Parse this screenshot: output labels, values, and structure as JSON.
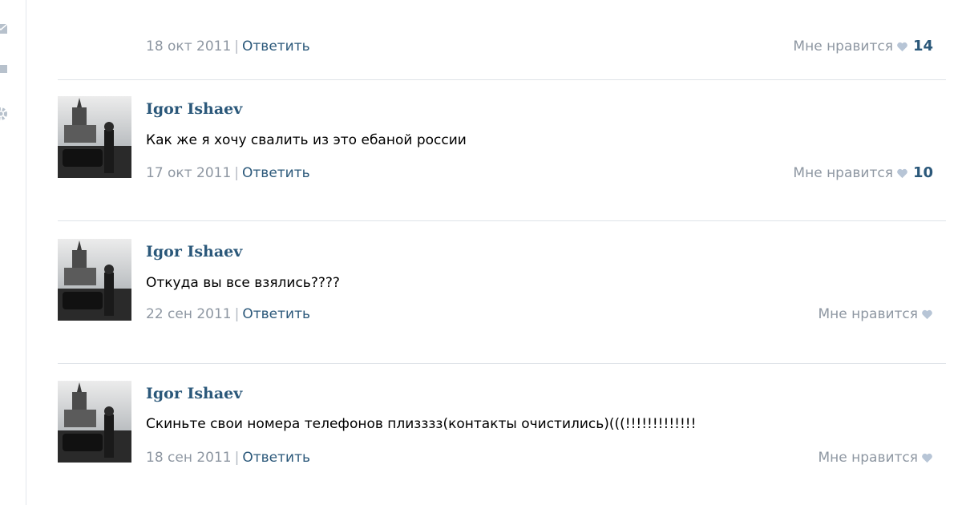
{
  "icons": {
    "rail": [
      "envelope-icon",
      "speech-bubble-icon",
      "gear-icon"
    ],
    "like": "heart-icon"
  },
  "colors": {
    "link": "#2b587a",
    "meta": "#8e97a2",
    "heart": "#b7c5d6",
    "divider": "#dfe3e8"
  },
  "separator": "|",
  "reply_label": "Ответить",
  "like_label": "Мне нравится",
  "top_comment": {
    "date": "18 окт 2011",
    "likes": "14"
  },
  "comments": [
    {
      "author": "Igor Ishaev",
      "text": "Как же я хочу свалить из это ебаной россии",
      "date": "17 окт 2011",
      "likes": "10"
    },
    {
      "author": "Igor Ishaev",
      "text": "Откуда вы все взялись????",
      "date": "22 сен 2011",
      "likes": ""
    },
    {
      "author": "Igor Ishaev",
      "text": "Скиньте свои номера телефонов плизззз(контакты очистились)(((!!!!!!!!!!!!!",
      "date": "18 сен 2011",
      "likes": ""
    }
  ]
}
